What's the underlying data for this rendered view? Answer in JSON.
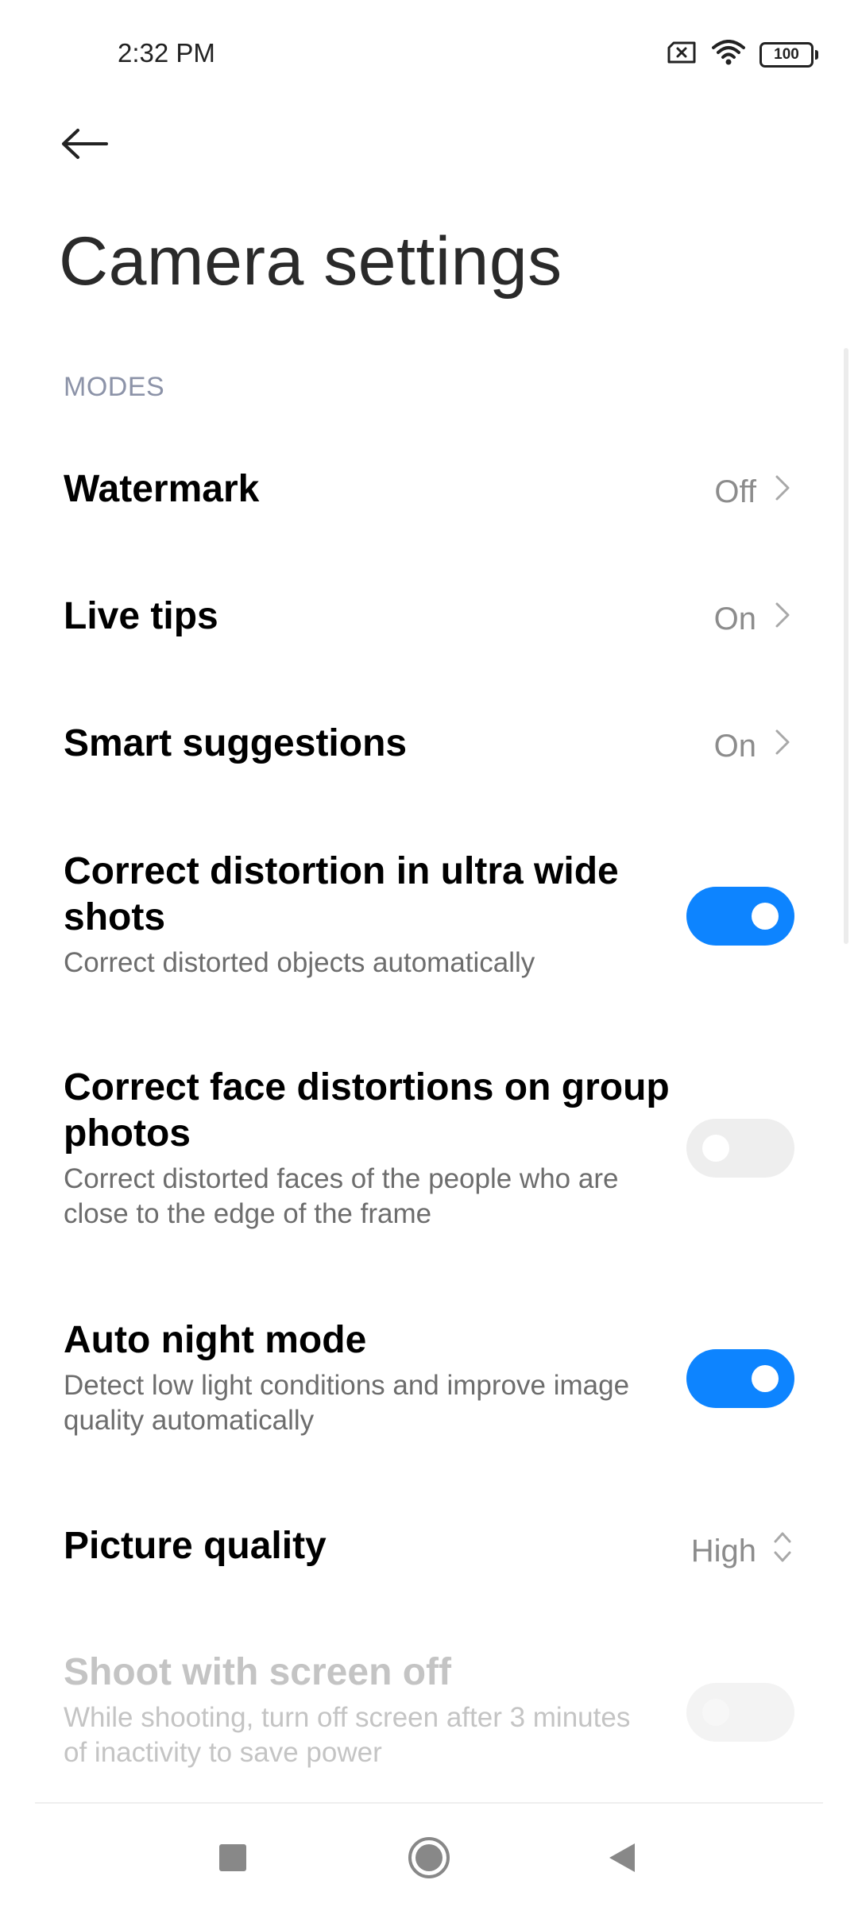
{
  "status_bar": {
    "time": "2:32 PM",
    "battery": "100",
    "icons": [
      "no-sim-icon",
      "wifi-icon",
      "battery-icon"
    ]
  },
  "header": {
    "back_icon": "arrow-left-icon",
    "title": "Camera settings"
  },
  "section": {
    "header": "MODES"
  },
  "rows": {
    "watermark": {
      "title": "Watermark",
      "value": "Off"
    },
    "live_tips": {
      "title": "Live tips",
      "value": "On"
    },
    "smart_suggestions": {
      "title": "Smart suggestions",
      "value": "On"
    },
    "ultra_wide": {
      "title": "Correct distortion in ultra wide shots",
      "subtitle": "Correct distorted objects automatically",
      "enabled": true
    },
    "face_distortion": {
      "title": "Correct face distortions on group photos",
      "subtitle": "Correct distorted faces of the people who are close to the edge of the frame",
      "enabled": false
    },
    "auto_night": {
      "title": "Auto night mode",
      "subtitle": "Detect low light conditions and improve image quality automatically",
      "enabled": true
    },
    "picture_quality": {
      "title": "Picture quality",
      "value": "High"
    },
    "screen_off": {
      "title": "Shoot with screen off",
      "subtitle": "While shooting, turn off screen after 3 minutes of inactivity to save power",
      "enabled": false,
      "disabled": true
    }
  },
  "colors": {
    "accent": "#0d84ff",
    "section_header": "#8c93a8",
    "value_text": "#8c8c8c"
  },
  "nav_bar": {
    "icons": [
      "recents-square-icon",
      "home-circle-icon",
      "back-triangle-icon"
    ]
  }
}
